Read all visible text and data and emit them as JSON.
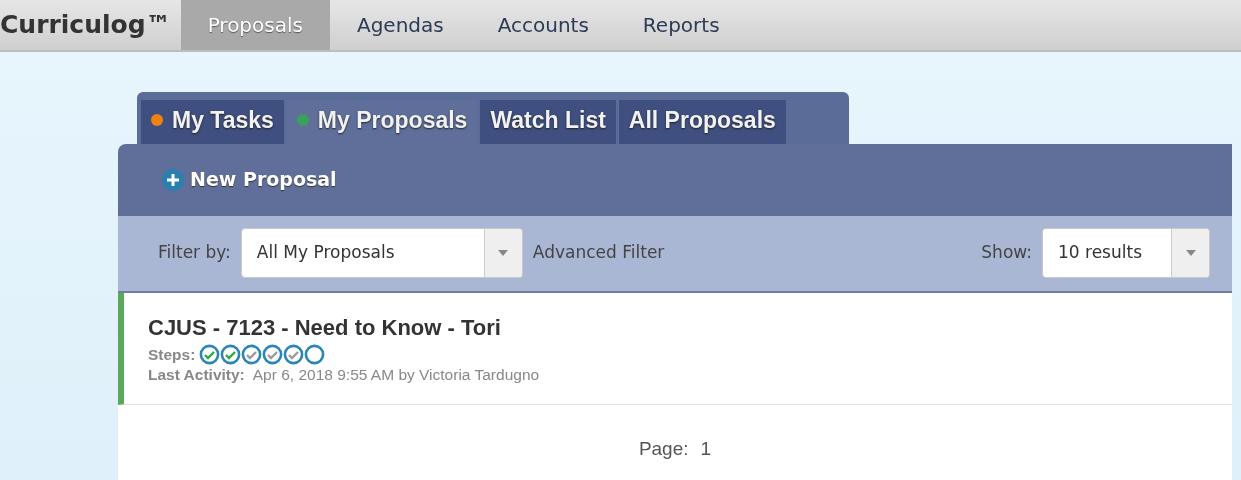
{
  "navbar": {
    "brand": "Curriculog™",
    "items": [
      {
        "label": "Proposals",
        "selected": true
      },
      {
        "label": "Agendas",
        "selected": false
      },
      {
        "label": "Accounts",
        "selected": false
      },
      {
        "label": "Reports",
        "selected": false
      }
    ]
  },
  "tabs": [
    {
      "label": "My Tasks",
      "selected": false,
      "color": "#f0820f"
    },
    {
      "label": "My Proposals",
      "selected": true,
      "color": "#3aa05a"
    },
    {
      "label": "Watch List",
      "selected": false
    },
    {
      "label": "All Proposals",
      "selected": false
    }
  ],
  "new_button": {
    "label": "New Proposal"
  },
  "filter": {
    "label": "Filter by:",
    "value": "All My Proposals",
    "advanced": "Advanced Filter",
    "show_label": "Show:",
    "show_value": "10 results"
  },
  "proposals": [
    {
      "title": "CJUS - 7123 - Need to Know - Tori",
      "steps_label": "Steps:",
      "steps": [
        {
          "kind": "done"
        },
        {
          "kind": "done"
        },
        {
          "kind": "approved"
        },
        {
          "kind": "approved"
        },
        {
          "kind": "approved"
        },
        {
          "kind": "open"
        }
      ],
      "activity_label": "Last Activity:",
      "activity": "Apr 6, 2018 9:55 AM by Victoria Tardugno"
    }
  ],
  "pager": {
    "label": "Page:",
    "page": "1"
  }
}
